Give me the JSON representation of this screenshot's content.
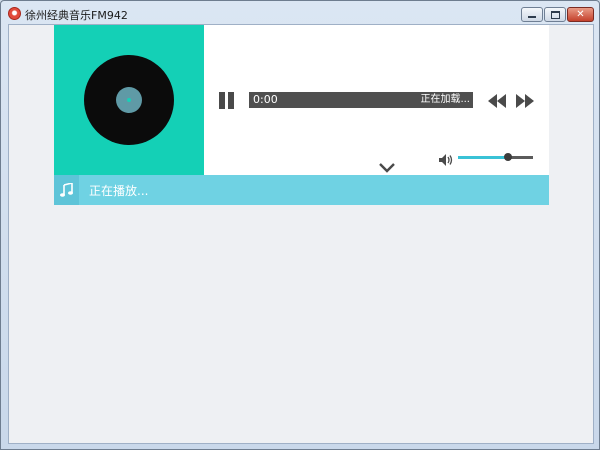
{
  "window": {
    "title": "徐州经典音乐FM942",
    "controls": {
      "minimize": "minimize",
      "maximize": "maximize",
      "close": "✕"
    }
  },
  "player": {
    "elapsed_time": "0:00",
    "status": "正在加载...",
    "now_playing_label": "正在播放...",
    "volume_level_fraction": 0.67
  },
  "icons": {
    "app": "radio-icon",
    "disc": "vinyl-record-icon",
    "pause": "pause-icon",
    "prev": "rewind-icon",
    "next": "fast-forward-icon",
    "expand": "chevron-down-icon",
    "volume": "speaker-icon",
    "note": "music-note-icon"
  },
  "colors": {
    "cover_bg": "#14d0b6",
    "disc": "#0b0b0b",
    "now_bar": "#6fd2e3",
    "accent": "#39c2d6",
    "progress_bar": "#4f4f4f",
    "client_bg": "#eef0f3"
  }
}
